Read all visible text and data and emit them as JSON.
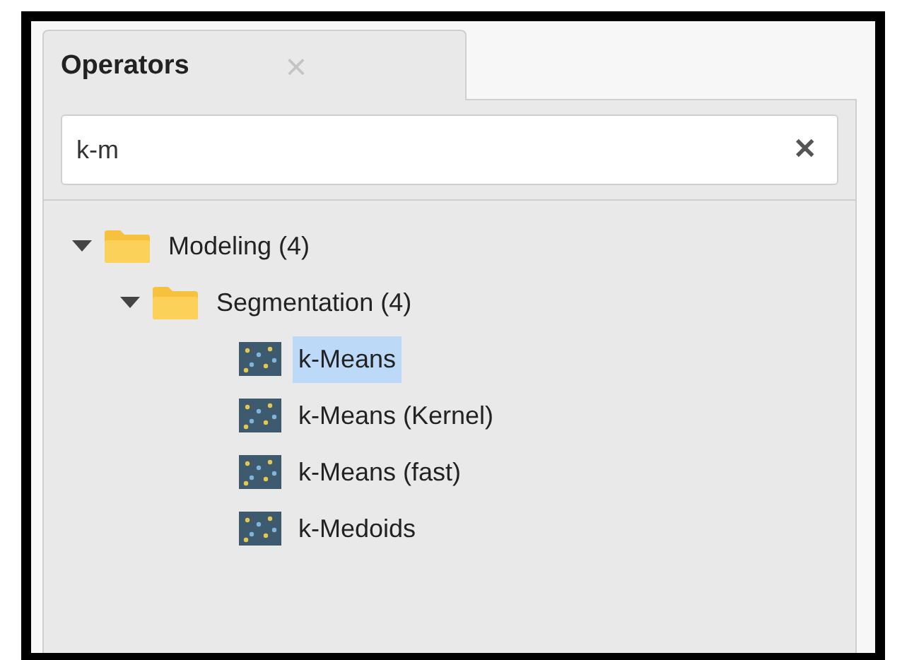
{
  "tabs": [
    {
      "label": "Operators",
      "close": "×",
      "selected": true
    }
  ],
  "search": {
    "value": "k-m",
    "clear": "✕"
  },
  "tree": [
    {
      "kind": "folder",
      "label": "Modeling (4)",
      "expanded": true,
      "selected": false,
      "children": [
        {
          "kind": "folder",
          "label": "Segmentation (4)",
          "expanded": true,
          "selected": false,
          "children": [
            {
              "kind": "operator",
              "label": "k-Means",
              "selected": true
            },
            {
              "kind": "operator",
              "label": "k-Means (Kernel)",
              "selected": false
            },
            {
              "kind": "operator",
              "label": "k-Means (fast)",
              "selected": false
            },
            {
              "kind": "operator",
              "label": "k-Medoids",
              "selected": false
            }
          ]
        }
      ]
    }
  ]
}
